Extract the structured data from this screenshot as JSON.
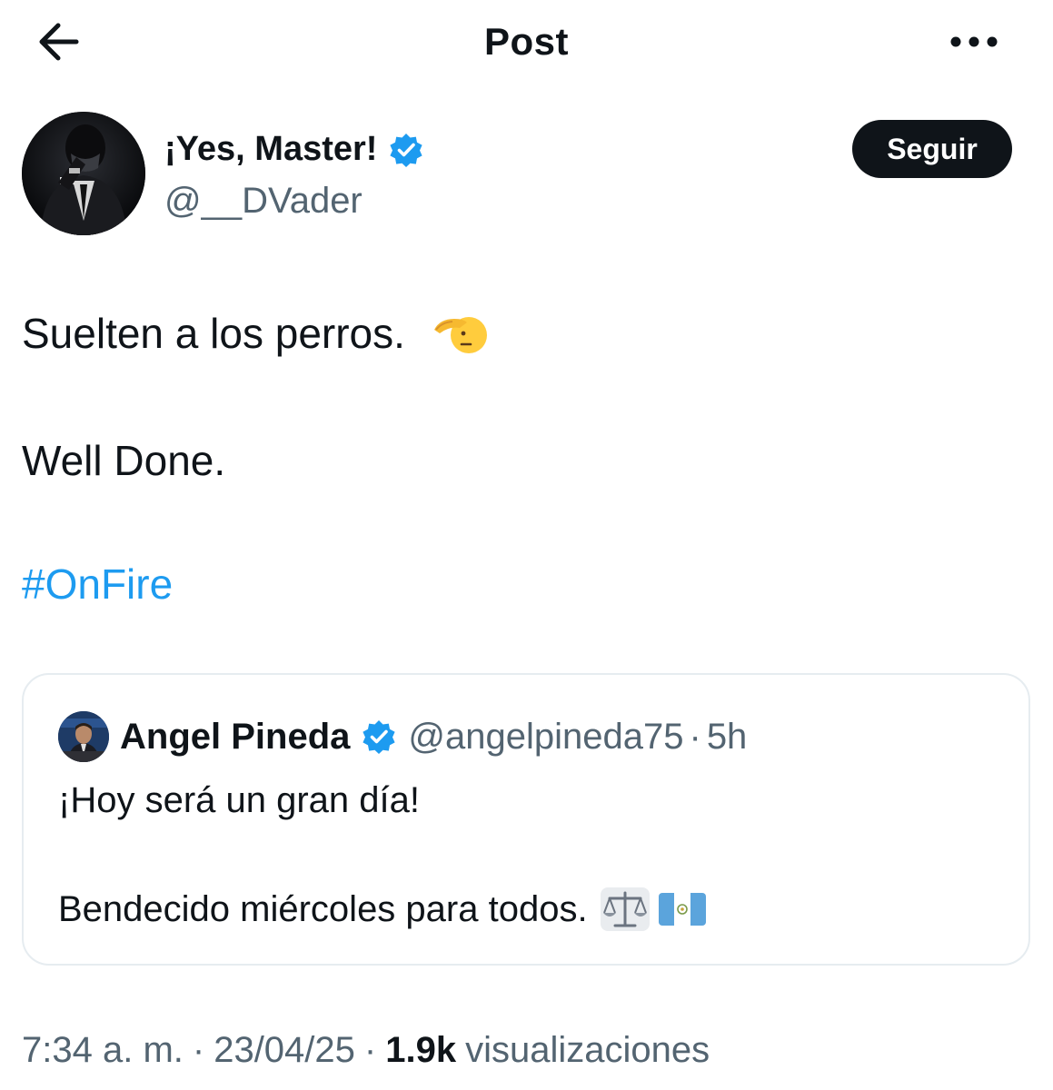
{
  "header": {
    "title": "Post",
    "back_icon": "arrow-left-icon",
    "more_icon": "more-horizontal-icon"
  },
  "author": {
    "name": "¡Yes, Master!",
    "handle": "@__DVader",
    "verified": true,
    "follow_label": "Seguir"
  },
  "tweet": {
    "line1": "Suelten a los perros.",
    "line1_emoji": "saluting-face-icon",
    "line2": "Well Done.",
    "hashtag": "#OnFire"
  },
  "quote": {
    "name": "Angel Pineda",
    "handle": "@angelpineda75",
    "separator": "·",
    "time": "5h",
    "verified": true,
    "text1": "¡Hoy será un gran día!",
    "text2": "Bendecido miércoles para todos.",
    "text2_emojis": [
      "balance-scale-icon",
      "guatemala-flag-icon"
    ]
  },
  "meta": {
    "time": "7:34 a. m.",
    "separator": "·",
    "date": "23/04/25",
    "views_count": "1.9k",
    "views_label": "visualizaciones"
  },
  "colors": {
    "link": "#1d9bf0",
    "verified": "#1d9bf0",
    "secondary_text": "#536471",
    "button_bg": "#0f1419"
  }
}
